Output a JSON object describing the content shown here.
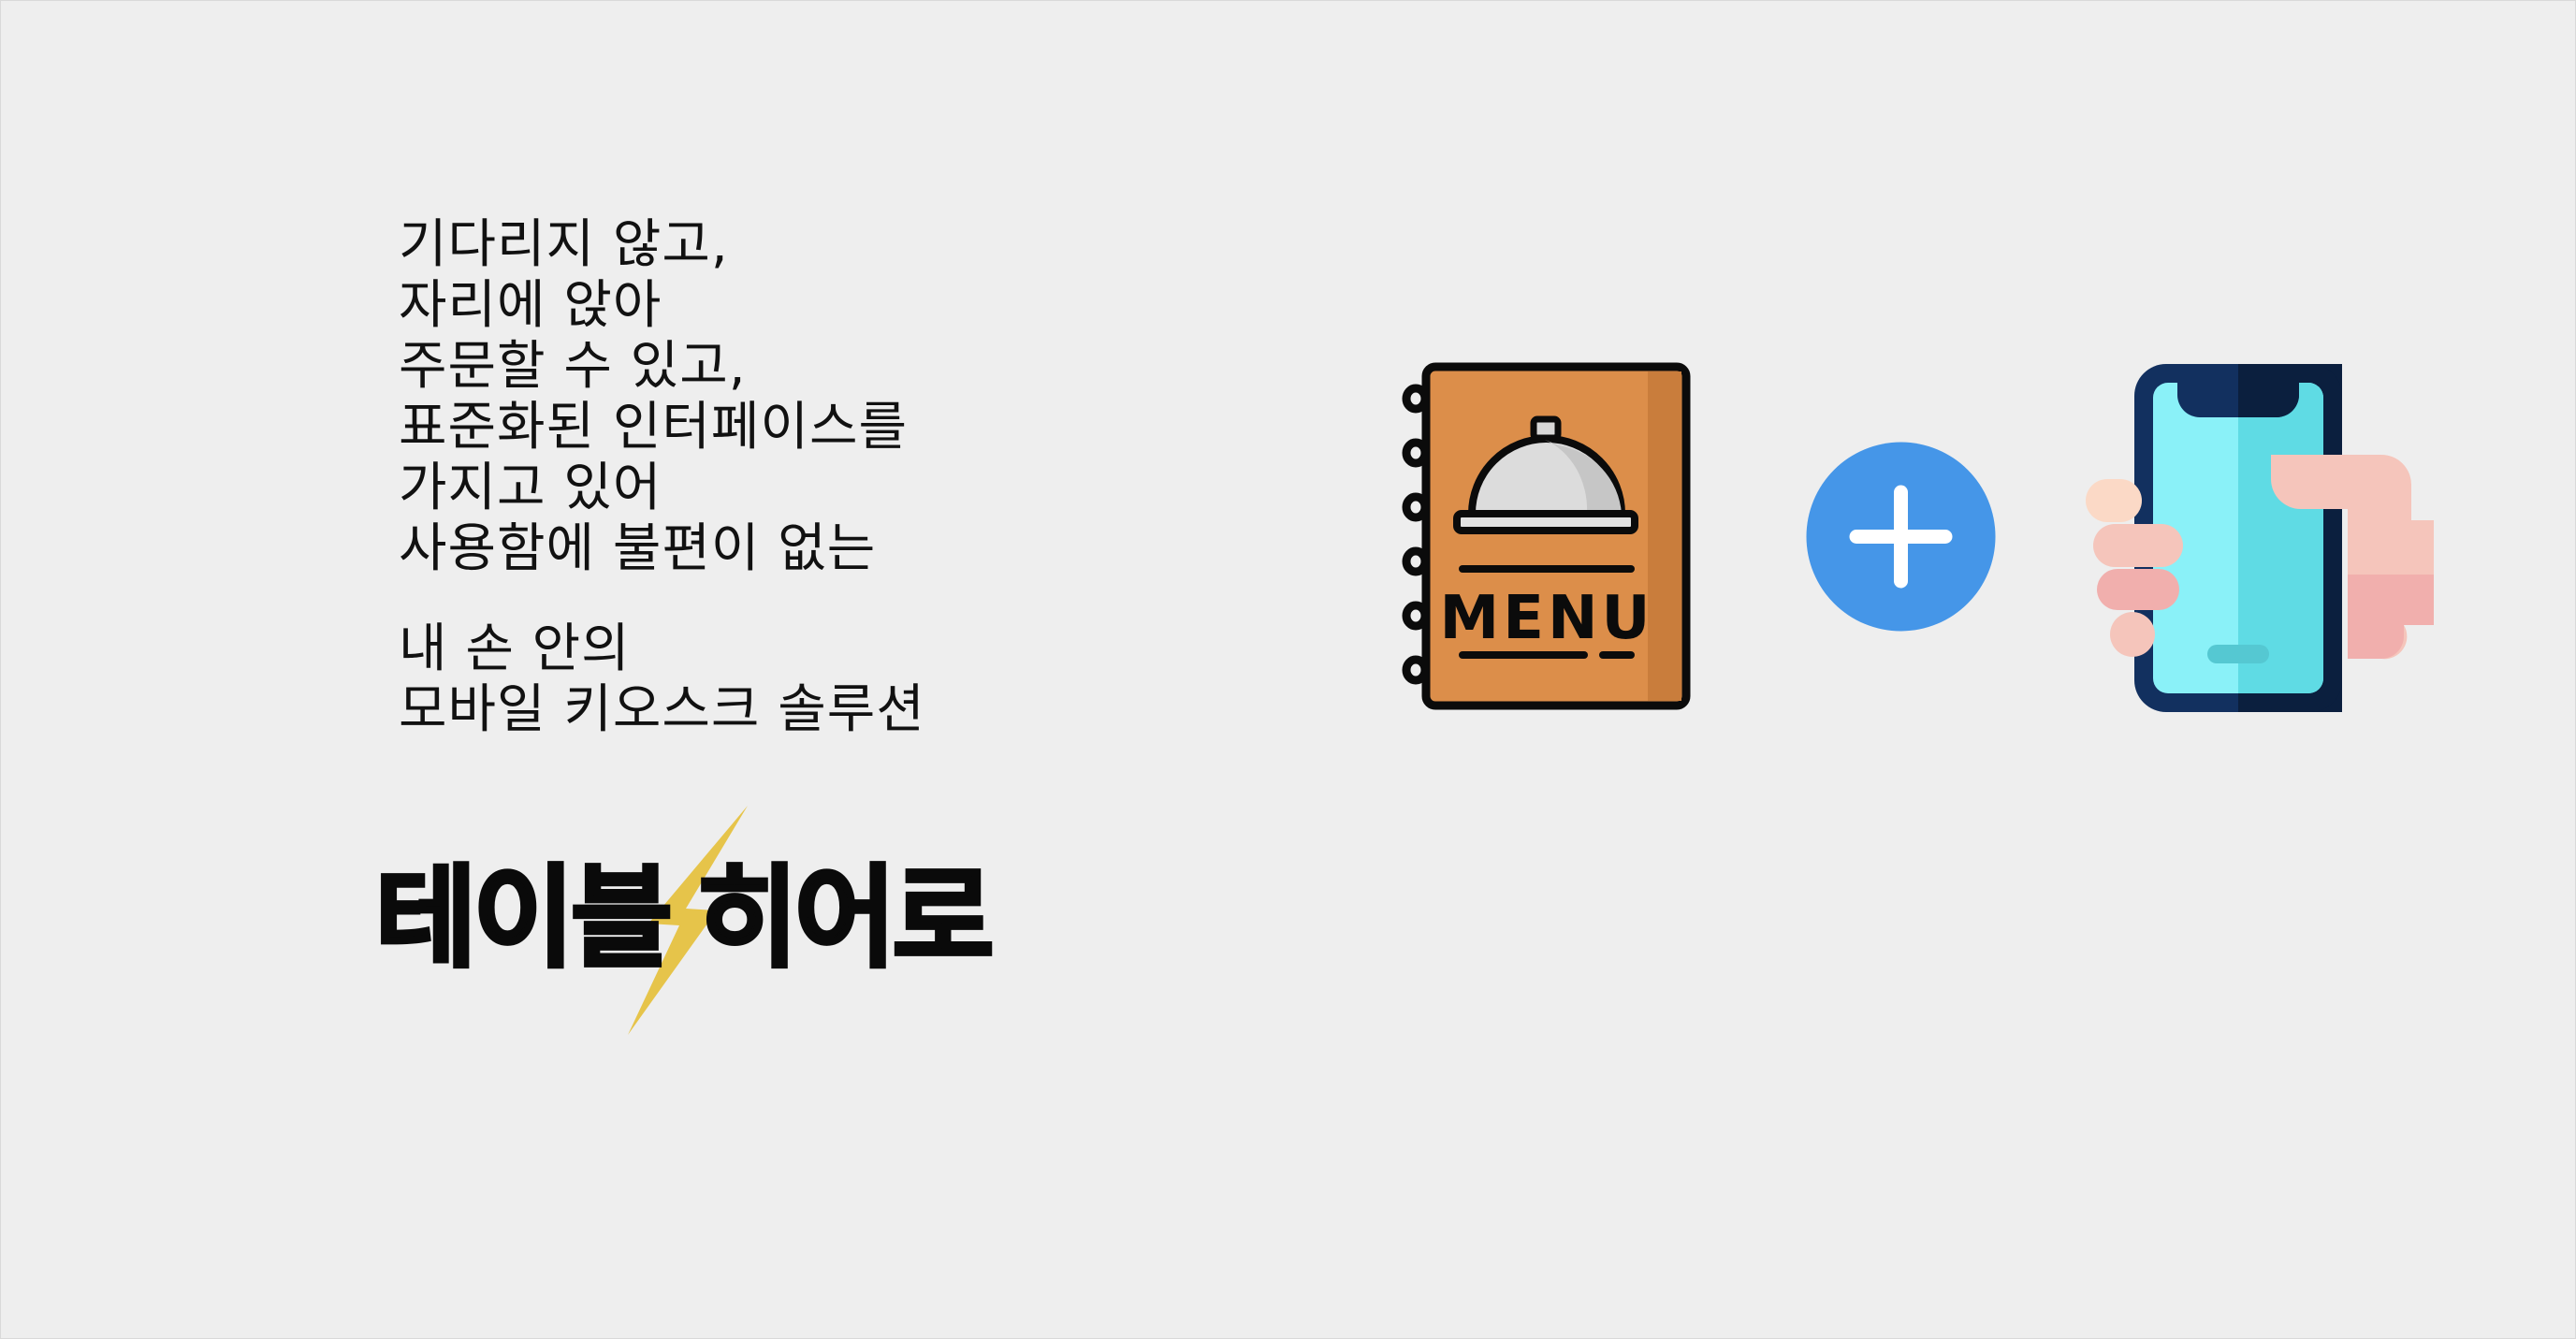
{
  "tagline": {
    "lines1": [
      "기다리지 않고,",
      "자리에 앉아",
      "주문할 수 있고,",
      "표준화된 인터페이스를",
      "가지고 있어",
      "사용함에 불편이 없는"
    ],
    "lines2": [
      "내 손 안의",
      "모바일 키오스크 솔루션"
    ]
  },
  "logo": {
    "part1": "테이블",
    "part2": "히어로",
    "bolt_color": "#e6c44a"
  },
  "icons": {
    "menu_book": "menu-book-icon",
    "menu_book_label": "MENU",
    "plus": "plus-icon",
    "phone": "hand-holding-phone-icon"
  },
  "colors": {
    "background": "#eeeeee",
    "menu_book": "#dc8e4a",
    "plus_circle": "#4596e8",
    "phone_screen": "#8af1f8",
    "phone_frame": "#12305f"
  }
}
